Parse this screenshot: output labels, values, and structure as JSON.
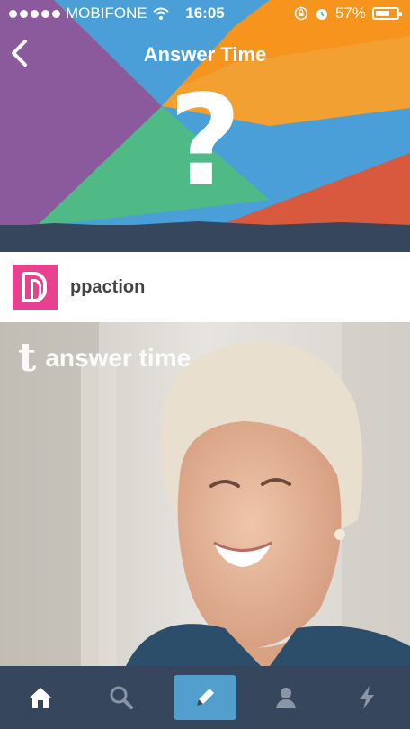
{
  "status_bar": {
    "carrier": "MOBIFONE",
    "time": "16:05",
    "battery": "57%"
  },
  "header": {
    "title": "Answer Time",
    "question_mark": "?",
    "colors": {
      "purple": "#8b5a9c",
      "green": "#4fba85",
      "blue": "#4a9fd8",
      "orange": "#f7941d",
      "red": "#d9593e",
      "navy": "#36465d"
    }
  },
  "blog": {
    "name": "ppaction",
    "avatar_color": "#e9408f"
  },
  "photo": {
    "watermark_text": "answer time"
  },
  "tab_bar": {
    "items": [
      "home-icon",
      "search-icon",
      "compose-icon",
      "account-icon",
      "activity-icon"
    ],
    "accent": "#529ecc"
  }
}
